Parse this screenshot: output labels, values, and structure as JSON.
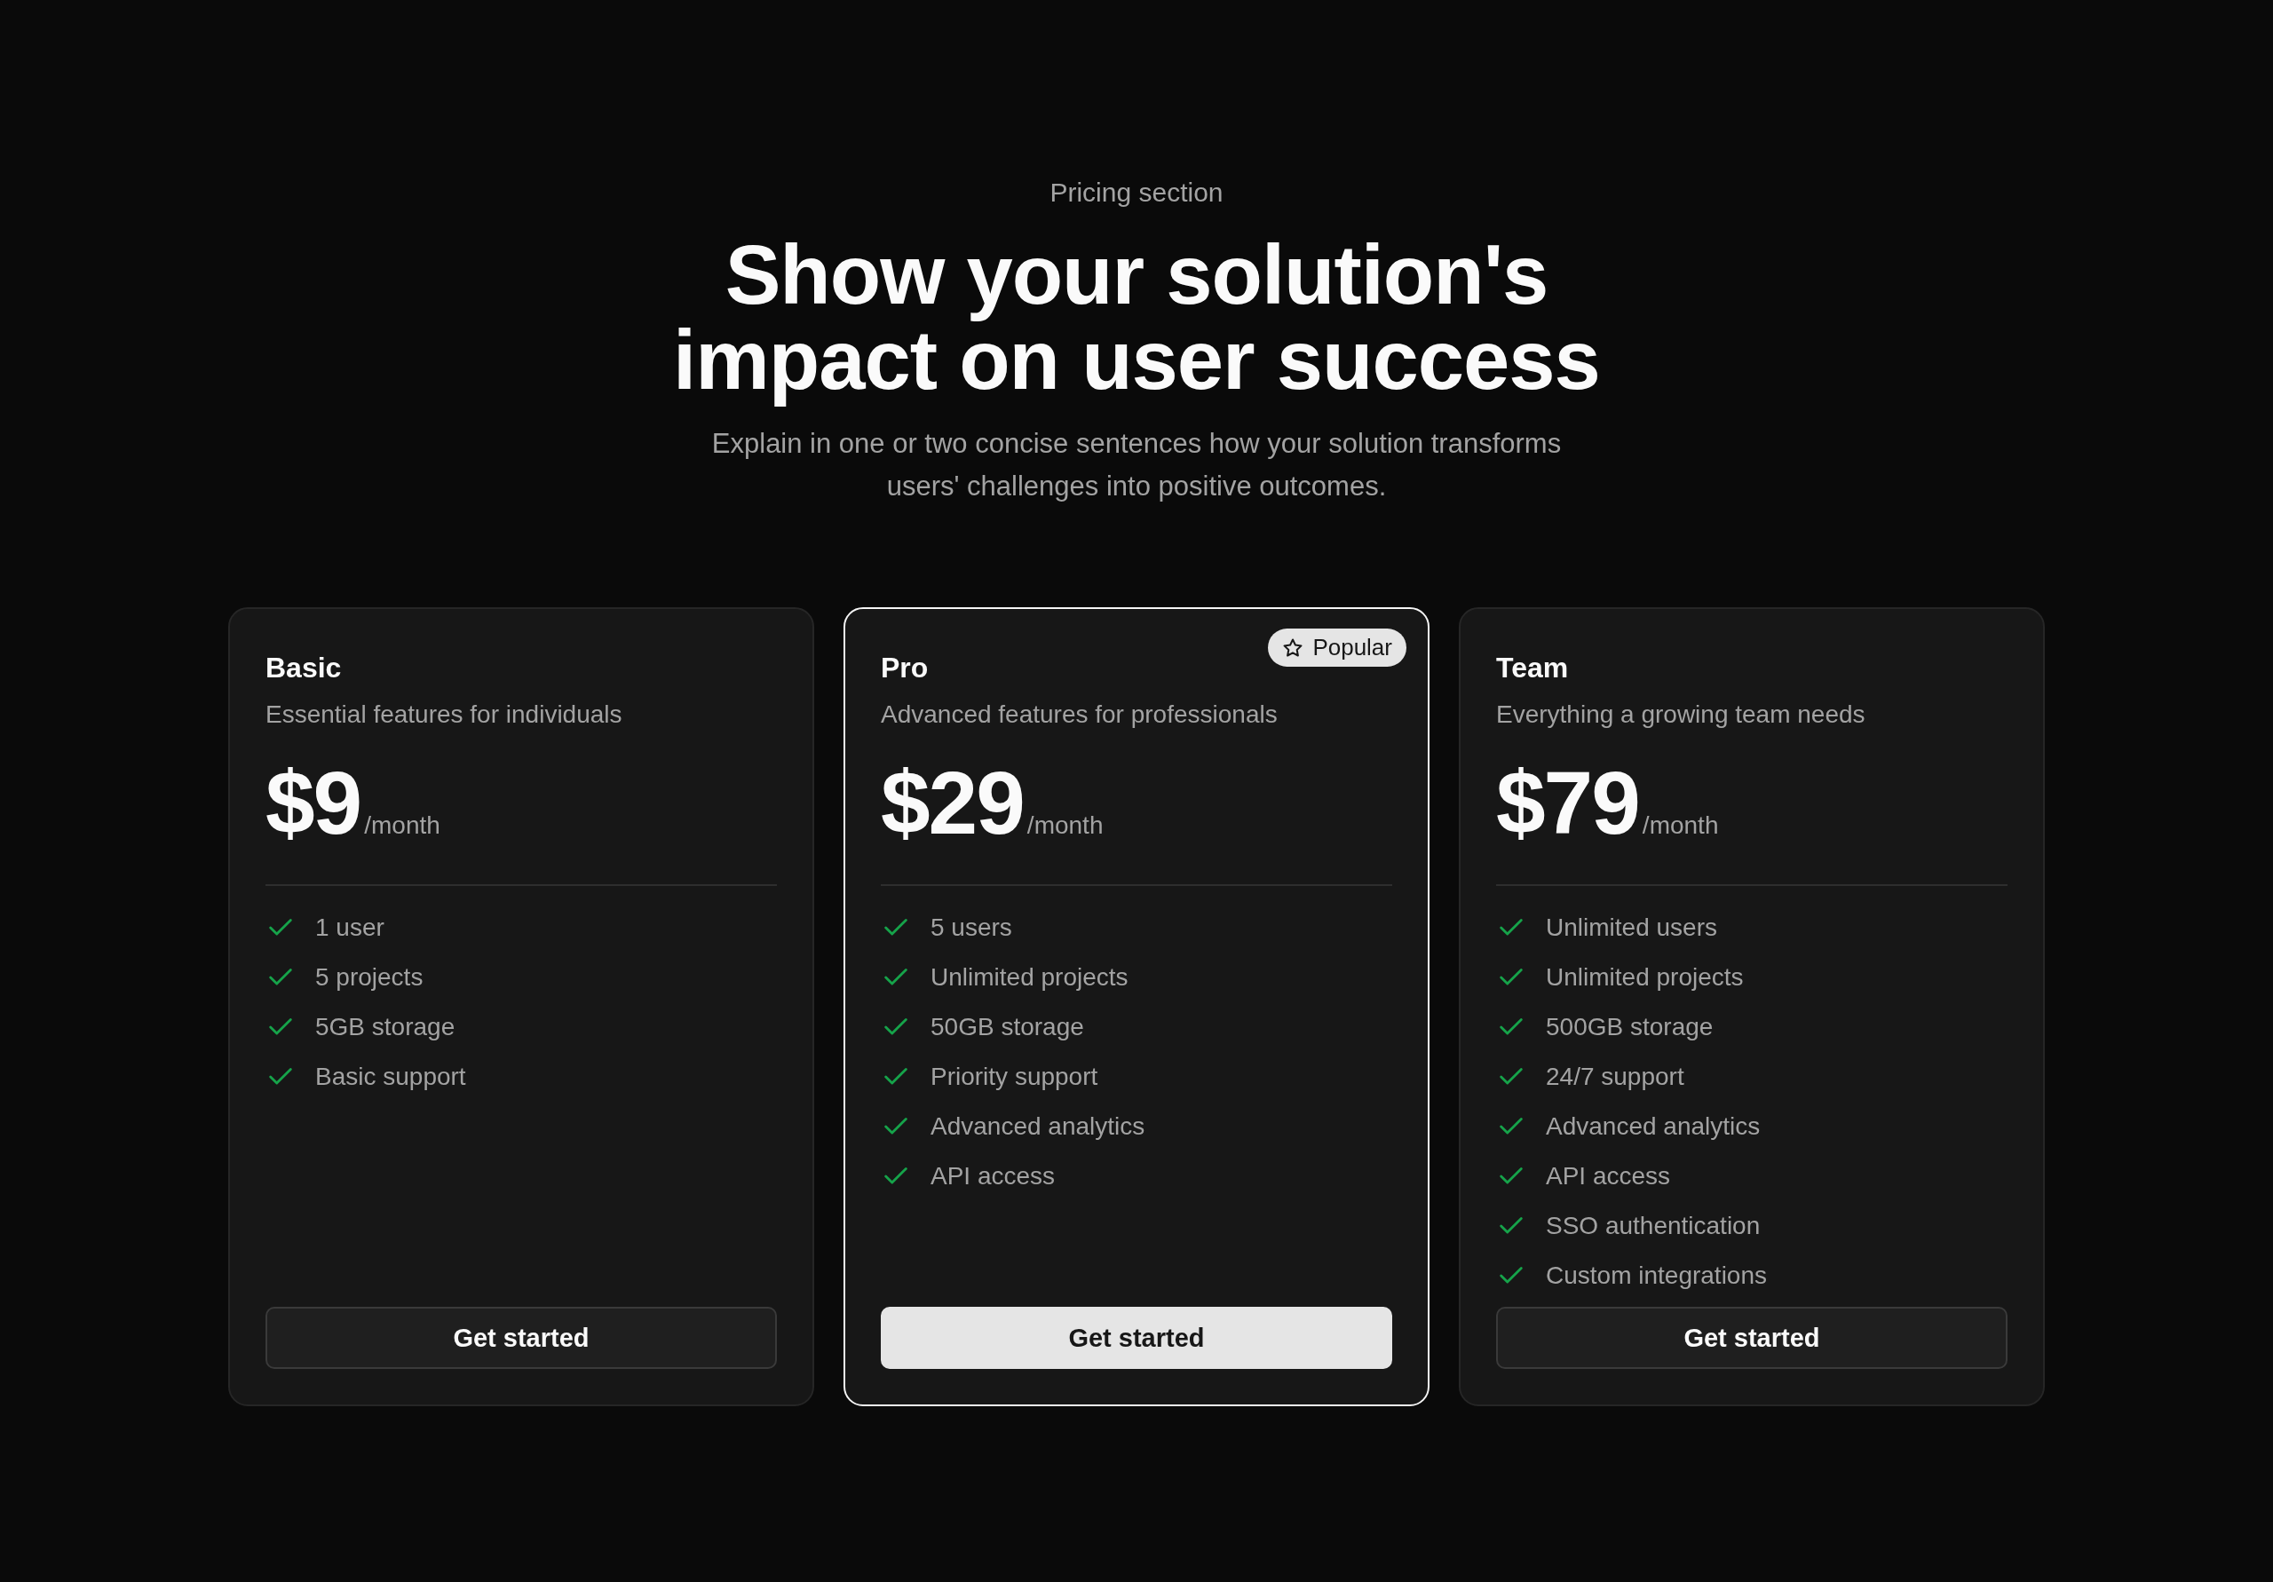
{
  "header": {
    "eyebrow": "Pricing section",
    "title": "Show your solution's impact on user success",
    "subtitle": "Explain in one or two concise sentences how your solution transforms users' challenges into positive outcomes."
  },
  "plans": [
    {
      "name": "Basic",
      "description": "Essential features for individuals",
      "price": "$9",
      "period": "/month",
      "featured": false,
      "features": [
        "1 user",
        "5 projects",
        "5GB storage",
        "Basic support"
      ],
      "button": "Get started"
    },
    {
      "name": "Pro",
      "description": "Advanced features for professionals",
      "price": "$29",
      "period": "/month",
      "featured": true,
      "badge": "Popular",
      "features": [
        "5 users",
        "Unlimited projects",
        "50GB storage",
        "Priority support",
        "Advanced analytics",
        "API access"
      ],
      "button": "Get started"
    },
    {
      "name": "Team",
      "description": "Everything a growing team needs",
      "price": "$79",
      "period": "/month",
      "featured": false,
      "features": [
        "Unlimited users",
        "Unlimited projects",
        "500GB storage",
        "24/7 support",
        "Advanced analytics",
        "API access",
        "SSO authentication",
        "Custom integrations"
      ],
      "button": "Get started"
    }
  ]
}
